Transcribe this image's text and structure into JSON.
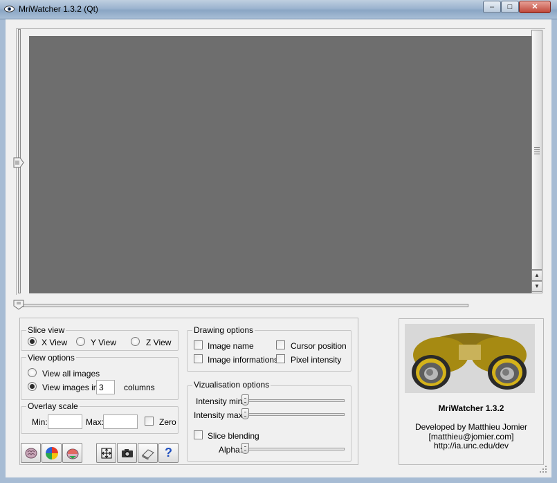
{
  "window": {
    "title": "MriWatcher 1.3.2 (Qt)",
    "minimize_glyph": "–",
    "maximize_glyph": "□",
    "close_glyph": "✕",
    "icon": "eye-icon",
    "accent": "#a7bcd4"
  },
  "viewer": {
    "background": "#6e6e6e",
    "vertical_slider_icon": "slider-thumb-icon",
    "horizontal_slider_icon": "slider-thumb-icon"
  },
  "slice_view": {
    "title": "Slice view",
    "options": [
      "X View",
      "Y View",
      "Z View"
    ],
    "selected": "X View"
  },
  "view_options": {
    "title": "View options",
    "view_all_label": "View all images",
    "view_images_in_label": "View images in",
    "columns_value": "3",
    "columns_label": "columns",
    "selected": "View images in"
  },
  "overlay_scale": {
    "title": "Overlay scale",
    "min_label": "Min:",
    "max_label": "Max:",
    "min_value": "",
    "max_value": "",
    "zero_label": "Zero",
    "zero_checked": false
  },
  "drawing_options": {
    "title": "Drawing options",
    "image_name": "Image name",
    "cursor_position": "Cursor position",
    "image_informations": "Image informations",
    "pixel_intensity": "Pixel intensity"
  },
  "vizualisation_options": {
    "title": "Vizualisation options",
    "intensity_min_label": "Intensity min:",
    "intensity_max_label": "Intensity max:",
    "intensity_min_level": 0,
    "intensity_max_level": 0,
    "slice_blending_label": "Slice blending",
    "alpha_label": "Alpha:",
    "alpha_level": 0
  },
  "toolbar": {
    "buttons": [
      "brain-icon",
      "color-wheel-icon",
      "overlay-icon",
      "fit-view-icon",
      "camera-icon",
      "eraser-icon",
      "help-icon"
    ],
    "help_glyph": "?"
  },
  "about": {
    "name": "MriWatcher 1.3.2",
    "developed_by": "Developed by Matthieu Jomier",
    "email": "[matthieu@jomier.com]",
    "url": "http://ia.unc.edu/dev",
    "logo_icon": "binoculars-logo-icon"
  }
}
